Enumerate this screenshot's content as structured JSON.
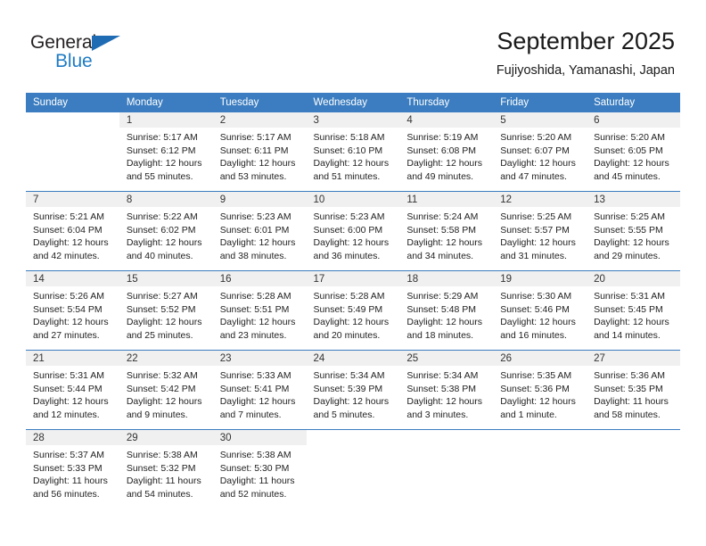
{
  "brand": {
    "word_one": "General",
    "word_two": "Blue",
    "triangle_color": "#1f6cb4",
    "blue_text_color": "#1f7bc4"
  },
  "header": {
    "title": "September 2025",
    "subtitle": "Fujiyoshida, Yamanashi, Japan"
  },
  "theme": {
    "header_row_bg": "#3b7dc0",
    "daynum_bg": "#f0f0f0",
    "grid_line": "#3b7dc0",
    "text": "#222222"
  },
  "weekday_headers": [
    "Sunday",
    "Monday",
    "Tuesday",
    "Wednesday",
    "Thursday",
    "Friday",
    "Saturday"
  ],
  "weeks": [
    [
      {
        "day": "",
        "sunrise": "",
        "sunset": "",
        "daylight_line1": "",
        "daylight_line2": ""
      },
      {
        "day": "1",
        "sunrise": "Sunrise: 5:17 AM",
        "sunset": "Sunset: 6:12 PM",
        "daylight_line1": "Daylight: 12 hours",
        "daylight_line2": "and 55 minutes."
      },
      {
        "day": "2",
        "sunrise": "Sunrise: 5:17 AM",
        "sunset": "Sunset: 6:11 PM",
        "daylight_line1": "Daylight: 12 hours",
        "daylight_line2": "and 53 minutes."
      },
      {
        "day": "3",
        "sunrise": "Sunrise: 5:18 AM",
        "sunset": "Sunset: 6:10 PM",
        "daylight_line1": "Daylight: 12 hours",
        "daylight_line2": "and 51 minutes."
      },
      {
        "day": "4",
        "sunrise": "Sunrise: 5:19 AM",
        "sunset": "Sunset: 6:08 PM",
        "daylight_line1": "Daylight: 12 hours",
        "daylight_line2": "and 49 minutes."
      },
      {
        "day": "5",
        "sunrise": "Sunrise: 5:20 AM",
        "sunset": "Sunset: 6:07 PM",
        "daylight_line1": "Daylight: 12 hours",
        "daylight_line2": "and 47 minutes."
      },
      {
        "day": "6",
        "sunrise": "Sunrise: 5:20 AM",
        "sunset": "Sunset: 6:05 PM",
        "daylight_line1": "Daylight: 12 hours",
        "daylight_line2": "and 45 minutes."
      }
    ],
    [
      {
        "day": "7",
        "sunrise": "Sunrise: 5:21 AM",
        "sunset": "Sunset: 6:04 PM",
        "daylight_line1": "Daylight: 12 hours",
        "daylight_line2": "and 42 minutes."
      },
      {
        "day": "8",
        "sunrise": "Sunrise: 5:22 AM",
        "sunset": "Sunset: 6:02 PM",
        "daylight_line1": "Daylight: 12 hours",
        "daylight_line2": "and 40 minutes."
      },
      {
        "day": "9",
        "sunrise": "Sunrise: 5:23 AM",
        "sunset": "Sunset: 6:01 PM",
        "daylight_line1": "Daylight: 12 hours",
        "daylight_line2": "and 38 minutes."
      },
      {
        "day": "10",
        "sunrise": "Sunrise: 5:23 AM",
        "sunset": "Sunset: 6:00 PM",
        "daylight_line1": "Daylight: 12 hours",
        "daylight_line2": "and 36 minutes."
      },
      {
        "day": "11",
        "sunrise": "Sunrise: 5:24 AM",
        "sunset": "Sunset: 5:58 PM",
        "daylight_line1": "Daylight: 12 hours",
        "daylight_line2": "and 34 minutes."
      },
      {
        "day": "12",
        "sunrise": "Sunrise: 5:25 AM",
        "sunset": "Sunset: 5:57 PM",
        "daylight_line1": "Daylight: 12 hours",
        "daylight_line2": "and 31 minutes."
      },
      {
        "day": "13",
        "sunrise": "Sunrise: 5:25 AM",
        "sunset": "Sunset: 5:55 PM",
        "daylight_line1": "Daylight: 12 hours",
        "daylight_line2": "and 29 minutes."
      }
    ],
    [
      {
        "day": "14",
        "sunrise": "Sunrise: 5:26 AM",
        "sunset": "Sunset: 5:54 PM",
        "daylight_line1": "Daylight: 12 hours",
        "daylight_line2": "and 27 minutes."
      },
      {
        "day": "15",
        "sunrise": "Sunrise: 5:27 AM",
        "sunset": "Sunset: 5:52 PM",
        "daylight_line1": "Daylight: 12 hours",
        "daylight_line2": "and 25 minutes."
      },
      {
        "day": "16",
        "sunrise": "Sunrise: 5:28 AM",
        "sunset": "Sunset: 5:51 PM",
        "daylight_line1": "Daylight: 12 hours",
        "daylight_line2": "and 23 minutes."
      },
      {
        "day": "17",
        "sunrise": "Sunrise: 5:28 AM",
        "sunset": "Sunset: 5:49 PM",
        "daylight_line1": "Daylight: 12 hours",
        "daylight_line2": "and 20 minutes."
      },
      {
        "day": "18",
        "sunrise": "Sunrise: 5:29 AM",
        "sunset": "Sunset: 5:48 PM",
        "daylight_line1": "Daylight: 12 hours",
        "daylight_line2": "and 18 minutes."
      },
      {
        "day": "19",
        "sunrise": "Sunrise: 5:30 AM",
        "sunset": "Sunset: 5:46 PM",
        "daylight_line1": "Daylight: 12 hours",
        "daylight_line2": "and 16 minutes."
      },
      {
        "day": "20",
        "sunrise": "Sunrise: 5:31 AM",
        "sunset": "Sunset: 5:45 PM",
        "daylight_line1": "Daylight: 12 hours",
        "daylight_line2": "and 14 minutes."
      }
    ],
    [
      {
        "day": "21",
        "sunrise": "Sunrise: 5:31 AM",
        "sunset": "Sunset: 5:44 PM",
        "daylight_line1": "Daylight: 12 hours",
        "daylight_line2": "and 12 minutes."
      },
      {
        "day": "22",
        "sunrise": "Sunrise: 5:32 AM",
        "sunset": "Sunset: 5:42 PM",
        "daylight_line1": "Daylight: 12 hours",
        "daylight_line2": "and 9 minutes."
      },
      {
        "day": "23",
        "sunrise": "Sunrise: 5:33 AM",
        "sunset": "Sunset: 5:41 PM",
        "daylight_line1": "Daylight: 12 hours",
        "daylight_line2": "and 7 minutes."
      },
      {
        "day": "24",
        "sunrise": "Sunrise: 5:34 AM",
        "sunset": "Sunset: 5:39 PM",
        "daylight_line1": "Daylight: 12 hours",
        "daylight_line2": "and 5 minutes."
      },
      {
        "day": "25",
        "sunrise": "Sunrise: 5:34 AM",
        "sunset": "Sunset: 5:38 PM",
        "daylight_line1": "Daylight: 12 hours",
        "daylight_line2": "and 3 minutes."
      },
      {
        "day": "26",
        "sunrise": "Sunrise: 5:35 AM",
        "sunset": "Sunset: 5:36 PM",
        "daylight_line1": "Daylight: 12 hours",
        "daylight_line2": "and 1 minute."
      },
      {
        "day": "27",
        "sunrise": "Sunrise: 5:36 AM",
        "sunset": "Sunset: 5:35 PM",
        "daylight_line1": "Daylight: 11 hours",
        "daylight_line2": "and 58 minutes."
      }
    ],
    [
      {
        "day": "28",
        "sunrise": "Sunrise: 5:37 AM",
        "sunset": "Sunset: 5:33 PM",
        "daylight_line1": "Daylight: 11 hours",
        "daylight_line2": "and 56 minutes."
      },
      {
        "day": "29",
        "sunrise": "Sunrise: 5:38 AM",
        "sunset": "Sunset: 5:32 PM",
        "daylight_line1": "Daylight: 11 hours",
        "daylight_line2": "and 54 minutes."
      },
      {
        "day": "30",
        "sunrise": "Sunrise: 5:38 AM",
        "sunset": "Sunset: 5:30 PM",
        "daylight_line1": "Daylight: 11 hours",
        "daylight_line2": "and 52 minutes."
      },
      {
        "day": "",
        "sunrise": "",
        "sunset": "",
        "daylight_line1": "",
        "daylight_line2": ""
      },
      {
        "day": "",
        "sunrise": "",
        "sunset": "",
        "daylight_line1": "",
        "daylight_line2": ""
      },
      {
        "day": "",
        "sunrise": "",
        "sunset": "",
        "daylight_line1": "",
        "daylight_line2": ""
      },
      {
        "day": "",
        "sunrise": "",
        "sunset": "",
        "daylight_line1": "",
        "daylight_line2": ""
      }
    ]
  ]
}
